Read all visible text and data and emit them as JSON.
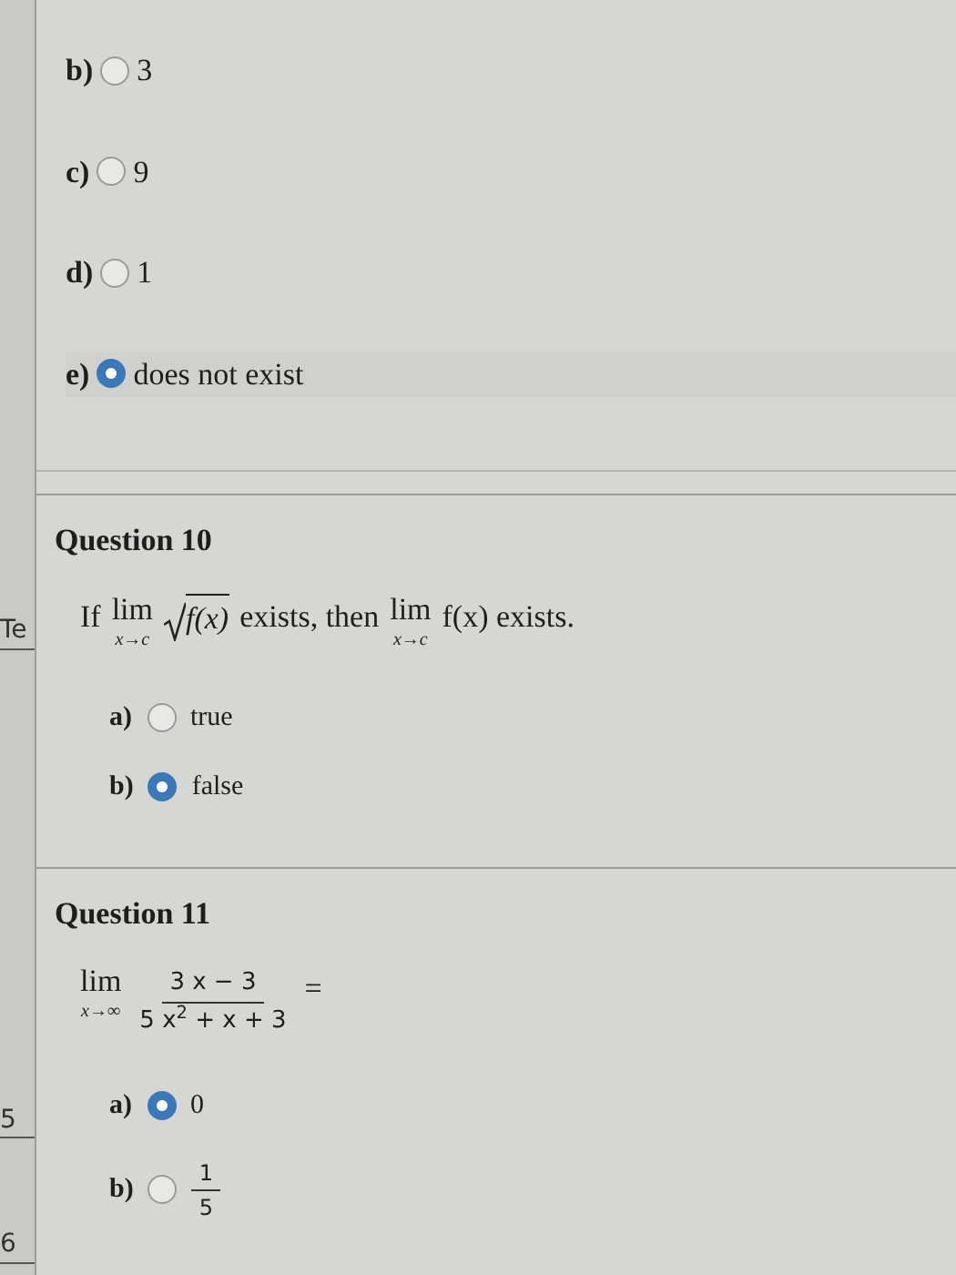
{
  "sidebar": {
    "items": [
      "Te",
      "5",
      "6"
    ]
  },
  "previous_options": [
    {
      "label": "b)",
      "text": "3",
      "selected": false
    },
    {
      "label": "c)",
      "text": "9",
      "selected": false
    },
    {
      "label": "d)",
      "text": "1",
      "selected": false
    },
    {
      "label": "e)",
      "text": "does not exist",
      "selected": true
    }
  ],
  "questions": [
    {
      "title": "Question 10",
      "prompt": [
        {
          "kind": "text",
          "text": "If"
        },
        {
          "kind": "limit",
          "text": "lim",
          "under": "x→c"
        },
        {
          "kind": "sqrt",
          "text": "f(x)"
        },
        {
          "kind": "text",
          "text": "exists, then"
        },
        {
          "kind": "limit",
          "text": "lim",
          "under": "x→c"
        },
        {
          "kind": "text",
          "text": "f(x) exists."
        }
      ],
      "options": [
        {
          "label": "a)",
          "kind": "text",
          "text": "true",
          "selected": false
        },
        {
          "label": "b)",
          "kind": "text",
          "text": "false",
          "selected": true
        }
      ]
    },
    {
      "title": "Question 11",
      "prompt": [
        {
          "kind": "limit",
          "text": "lim",
          "under": "x→∞"
        },
        {
          "kind": "fraction",
          "numerator": "3 x − 3",
          "denominator": "5 x$^{2}$ + x + 3"
        },
        {
          "kind": "text",
          "text": "="
        }
      ],
      "options": [
        {
          "label": "a)",
          "kind": "text",
          "text": "0",
          "selected": true
        },
        {
          "label": "b)",
          "kind": "fraction",
          "numerator": "1",
          "denominator": "5",
          "selected": false
        }
      ]
    }
  ]
}
